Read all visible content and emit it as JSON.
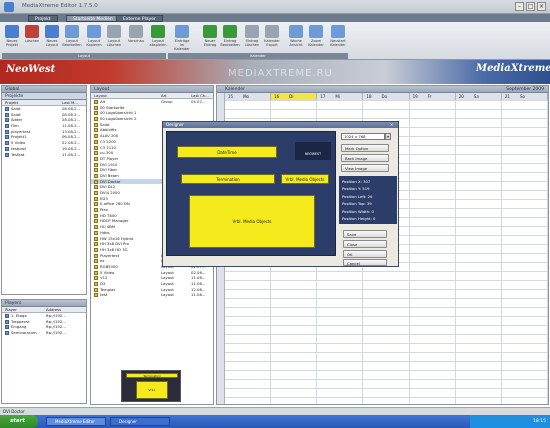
{
  "window": {
    "title": "MediaXtreme Editor 1.7.5.0"
  },
  "ribbon_tabs": [
    "Projekt",
    "Startseite Medien",
    "Externe Player"
  ],
  "ribbon_buttons": [
    {
      "label": "Neues Projekt",
      "icon": "new-project-icon",
      "color": "#4a7fd0"
    },
    {
      "label": "Löschen",
      "icon": "delete-icon",
      "color": "#c0403a"
    },
    {
      "label": "Neues Layout",
      "icon": "new-layout-icon",
      "color": "#4a7fd0"
    },
    {
      "label": "Layout Bearbeiten",
      "icon": "edit-layout-icon",
      "color": "#6e9bd8"
    },
    {
      "label": "Layout Kopieren",
      "icon": "copy-layout-icon",
      "color": "#6e9bd8"
    },
    {
      "label": "Layout Löschen",
      "icon": "delete-layout-icon",
      "color": "#9aa3b0"
    },
    {
      "label": "Vorschau",
      "icon": "preview-icon",
      "color": "#9aa3b0"
    },
    {
      "label": "Layout abspielen",
      "icon": "play-icon",
      "color": "#3a9a3a"
    },
    {
      "label": "Einträge im Kalender",
      "icon": "calendar-entries-icon",
      "color": "#6e9bd8"
    },
    {
      "label": "Neuer Eintrag",
      "icon": "new-entry-icon",
      "color": "#3a9a3a"
    },
    {
      "label": "Eintrag Bearbeiten",
      "icon": "edit-entry-icon",
      "color": "#3a9a3a"
    },
    {
      "label": "Eintrag Löschen",
      "icon": "delete-entry-icon",
      "color": "#9aa3b0"
    },
    {
      "label": "Kalender Export",
      "icon": "export-icon",
      "color": "#9aa3b0"
    },
    {
      "label": "Woche Ansicht",
      "icon": "week-view-icon",
      "color": "#6e9bd8"
    },
    {
      "label": "Zoom Kalender",
      "icon": "zoom-icon",
      "color": "#6e9bd8"
    },
    {
      "label": "Neustart Kalender",
      "icon": "restart-icon",
      "color": "#6e9bd8"
    }
  ],
  "ribbon_groups": [
    "Layout",
    "Kalender"
  ],
  "banner": {
    "logo": "NeoWest",
    "watermark": "MEDIAXTREME.RU",
    "right_logo": "MediaXtreme"
  },
  "global_panel": {
    "title": "Global",
    "projects_title": "Projekte",
    "columns": [
      "Projekt",
      "Last M..."
    ],
    "rows": [
      [
        "Salat",
        "08.08.2..."
      ],
      [
        "Salat",
        "08.08.2..."
      ],
      [
        "Adder",
        "28.08.2..."
      ],
      [
        "Film",
        "11.08.2..."
      ],
      [
        "playertest",
        "13.08.2..."
      ],
      [
        "Projekt1",
        "06.08.2..."
      ],
      [
        "5 Video",
        "22.08.2..."
      ],
      [
        "testprot",
        "16.08.2..."
      ],
      [
        "Testkat",
        "11.08.2..."
      ]
    ]
  },
  "players_panel": {
    "title": "Players",
    "columns": [
      "Player",
      "Address"
    ],
    "rows": [
      [
        "1. Etage",
        "ftp://192..."
      ],
      [
        "Treppenst",
        "ftp://192..."
      ],
      [
        "Eingang",
        "ftp://192..."
      ],
      [
        "Seminarraum",
        "ftp://192..."
      ]
    ]
  },
  "layout_panel": {
    "title": "Layout",
    "columns": [
      "Layout",
      "Art",
      "Last Ch..."
    ],
    "rows": [
      [
        "Alt",
        "Group",
        "04.07..."
      ],
      [
        "00 Startseite",
        "",
        ""
      ],
      [
        "00 Logoübersicht 1",
        "",
        ""
      ],
      [
        "00 Logoübersicht 2",
        "",
        ""
      ],
      [
        "Salat",
        "",
        ""
      ],
      [
        "Abbildfix",
        "",
        ""
      ],
      [
        "ALAV 200",
        "",
        ""
      ],
      [
        "C3 2200",
        "",
        ""
      ],
      [
        "C3 7110",
        "",
        ""
      ],
      [
        "cu-300",
        "",
        ""
      ],
      [
        "DT Player",
        "",
        ""
      ],
      [
        "DVI 1910",
        "",
        ""
      ],
      [
        "DVI Fiber",
        "",
        ""
      ],
      [
        "DVI Beam",
        "",
        ""
      ],
      [
        "DVI Doctor",
        "",
        ""
      ],
      [
        "DVI DL2",
        "",
        ""
      ],
      [
        "DVI4 2000",
        "",
        ""
      ],
      [
        "ED3",
        "",
        ""
      ],
      [
        "E-office 760 DN",
        "",
        ""
      ],
      [
        "Plex",
        "",
        ""
      ],
      [
        "HD 7800",
        "",
        ""
      ],
      [
        "HDCP Manager",
        "",
        ""
      ],
      [
        "HU 4BM",
        "",
        ""
      ],
      [
        "Hdbs",
        "",
        ""
      ],
      [
        "HW 15x16 Hybrid",
        "",
        ""
      ],
      [
        "HH 3x8 DVI Pro",
        "",
        ""
      ],
      [
        "HH 3x8 HD 3G",
        "",
        ""
      ],
      [
        "Playertest",
        "Layout",
        "13.08..."
      ],
      [
        "ex",
        "Layout",
        "11.08..."
      ],
      [
        "RGB5000",
        "Layout",
        "22.07..."
      ],
      [
        "5 Video",
        "Layout",
        "02.08..."
      ],
      [
        "V12",
        "Layout",
        "11.08..."
      ],
      [
        "D3",
        "Layout",
        "11.08..."
      ],
      [
        "Templat",
        "Layout",
        "12.08..."
      ],
      [
        "test",
        "Layout",
        "11.08..."
      ]
    ],
    "selected_index": 14,
    "preview_labels": [
      "Termination",
      "Vrbl. Media Objects",
      "Vrbl."
    ]
  },
  "calendar": {
    "title": "Kalender",
    "month": "September 2009",
    "days": [
      {
        "num": "15",
        "name": "Mo"
      },
      {
        "num": "16",
        "name": "Di"
      },
      {
        "num": "17",
        "name": "Mi"
      },
      {
        "num": "18",
        "name": "Do"
      },
      {
        "num": "19",
        "name": "Fr"
      },
      {
        "num": "20",
        "name": "Sa"
      },
      {
        "num": "21",
        "name": "So"
      }
    ],
    "highlight_index": 1
  },
  "designer_dialog": {
    "title": "Designer",
    "boxes": [
      "DateTime",
      "Termination",
      "Vrbl. Media Objects",
      "Vrbl. Media Objects"
    ],
    "logo_text": "NEOWEST",
    "resolution_value": "1024 x 768",
    "buttons": [
      "Mark Option",
      "Back Image",
      "View Image"
    ],
    "stats": [
      "Position X: 307",
      "Position Y: 519",
      "Position Left: 20",
      "Position Top: 39",
      "Position Width: 0",
      "Position Height: 0"
    ],
    "action_buttons": [
      "Save",
      "Close",
      "OK",
      "Cancel"
    ]
  },
  "status": {
    "text": "DVI Doctor"
  },
  "taskbar": {
    "start": "start",
    "items": [
      "MediaXtreme Editor",
      "Designer"
    ],
    "tray_time": "18:15"
  }
}
